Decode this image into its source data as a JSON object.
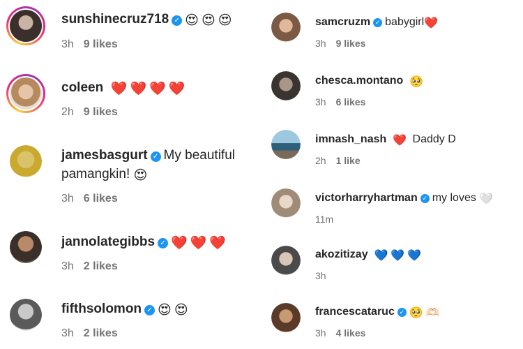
{
  "left_comments": [
    {
      "username": "sunshinecruz718",
      "verified": true,
      "text": "",
      "emojis": [
        "😍",
        "😍",
        "😍"
      ],
      "time": "3h",
      "likes": "9 likes",
      "avatar_ring": true
    },
    {
      "username": "coleen",
      "verified": false,
      "text": "",
      "emojis": [
        "❤️",
        "❤️",
        "❤️",
        "❤️"
      ],
      "time": "2h",
      "likes": "9 likes",
      "avatar_ring": true
    },
    {
      "username": "jamesbasgurt",
      "verified": true,
      "text": "My beautiful",
      "text2": "pamangkin!",
      "emojis": [
        "😍"
      ],
      "time": "3h",
      "likes": "6 likes",
      "avatar_ring": false
    },
    {
      "username": "jannolategibbs",
      "verified": true,
      "text": "",
      "emojis": [
        "❤️",
        "❤️",
        "❤️"
      ],
      "time": "3h",
      "likes": "2 likes",
      "avatar_ring": false
    },
    {
      "username": "fifthsolomon",
      "verified": true,
      "text": "",
      "emojis": [
        "😍",
        "😍"
      ],
      "time": "3h",
      "likes": "2 likes",
      "avatar_ring": false
    }
  ],
  "right_comments": [
    {
      "username": "samcruzm",
      "verified": true,
      "text": "babygirl",
      "emojis": [
        "❤️"
      ],
      "time": "3h",
      "likes": "9 likes"
    },
    {
      "username": "chesca.montano",
      "verified": false,
      "text": "",
      "emojis": [
        "🥺"
      ],
      "time": "3h",
      "likes": "6 likes"
    },
    {
      "username": "imnash_nash",
      "verified": false,
      "text": "Daddy D",
      "emojis_before": [
        "❤️"
      ],
      "emojis": [],
      "time": "2h",
      "likes": "1 like"
    },
    {
      "username": "victorharryhartman",
      "verified": true,
      "text": "my loves",
      "emojis": [
        "🤍"
      ],
      "time": "11m",
      "likes": ""
    },
    {
      "username": "akozitizay",
      "verified": false,
      "text": "",
      "emojis": [
        "💙",
        "💙",
        "💙"
      ],
      "time": "3h",
      "likes": ""
    },
    {
      "username": "francescataruc",
      "verified": true,
      "text": "",
      "emojis": [
        "🥺",
        "🫶🏻"
      ],
      "time": "3h",
      "likes": "4 likes"
    }
  ],
  "colors": {
    "verified": "#1d95f0",
    "meta": "#737373",
    "text": "#262626"
  }
}
